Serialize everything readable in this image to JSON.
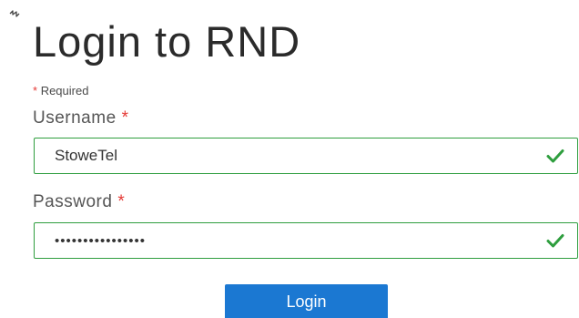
{
  "form": {
    "title": "Login to RND",
    "required_asterisk": "*",
    "required_note": "Required"
  },
  "username": {
    "label": "Username",
    "asterisk": "*",
    "value": "StoweTel",
    "valid_icon": "checkmark-icon"
  },
  "password": {
    "label": "Password",
    "asterisk": "*",
    "value": "••••••••••••••••",
    "valid_icon": "checkmark-icon"
  },
  "login_button": {
    "label": "Login"
  },
  "colors": {
    "valid_border": "#2e9e3e",
    "check": "#2e9e3e",
    "required": "#e53935",
    "primary_button": "#1b78d2"
  }
}
